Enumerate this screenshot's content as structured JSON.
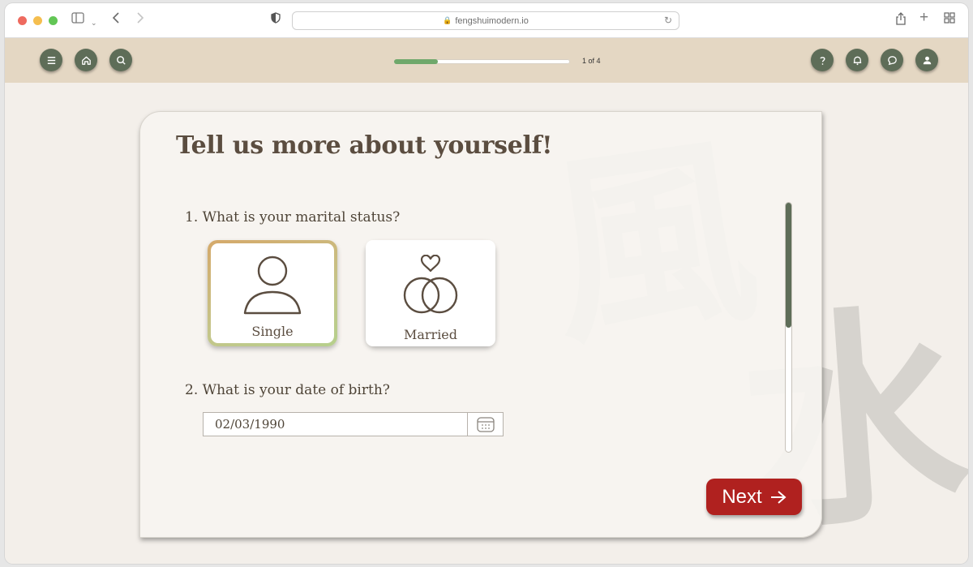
{
  "browser": {
    "url": "fengshuimodern.io"
  },
  "header": {
    "progress_fraction": 0.25,
    "progress_text": "1 of 4",
    "colors": {
      "header_bg": "#e4d7c3",
      "button": "#5e6d58",
      "progress": "#6fa86b"
    },
    "left_icons": [
      "menu-icon",
      "home-icon",
      "search-icon"
    ],
    "right_icons": [
      "help-icon",
      "notification-icon",
      "chat-icon",
      "profile-icon"
    ]
  },
  "card": {
    "title": "Tell us more about yourself!",
    "question1": "1. What is your marital status?",
    "options": [
      {
        "label": "Single",
        "icon": "person-icon",
        "selected": true
      },
      {
        "label": "Married",
        "icon": "rings-heart-icon",
        "selected": false
      }
    ],
    "question2": "2. What is your date of birth?",
    "dob_value": "02/03/1990",
    "next_label": "Next",
    "accent": "#b0211f"
  }
}
